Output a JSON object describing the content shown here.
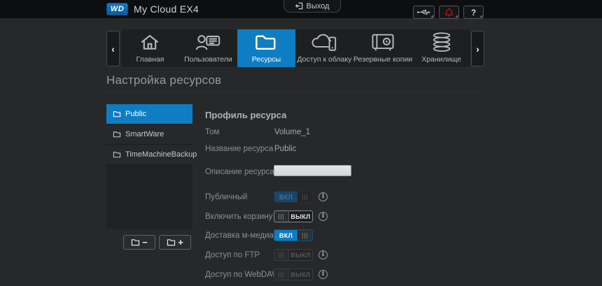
{
  "header": {
    "brand": {
      "logo": "WD",
      "title": "My Cloud EX4"
    },
    "logout_label": "Выход",
    "help_glyph": "?"
  },
  "nav": {
    "prev_glyph": "‹",
    "next_glyph": "›",
    "tabs": [
      {
        "label": "Главная",
        "icon": "home-icon",
        "active": false
      },
      {
        "label": "Пользователи",
        "icon": "users-icon",
        "active": false
      },
      {
        "label": "Ресурсы",
        "icon": "folder-icon",
        "active": true
      },
      {
        "label": "Доступ к облаку",
        "icon": "cloud-access-icon",
        "active": false
      },
      {
        "label": "Резервные копии",
        "icon": "backup-safe-icon",
        "active": false
      },
      {
        "label": "Хранилище",
        "icon": "storage-stack-icon",
        "active": false
      }
    ]
  },
  "page": {
    "title": "Настройка ресурсов"
  },
  "shares": {
    "items": [
      {
        "name": "Public",
        "selected": true
      },
      {
        "name": "SmartWare",
        "selected": false
      },
      {
        "name": "TimeMachineBackup",
        "selected": false
      }
    ],
    "remove_glyph": "−",
    "add_glyph": "+"
  },
  "profile": {
    "title": "Профиль ресурса",
    "volume_label": "Том",
    "volume_value": "Volume_1",
    "name_label": "Название ресурса",
    "name_value": "Public",
    "description_label": "Описание ресурса",
    "description_value": "",
    "info_glyph": "i",
    "toggles": [
      {
        "label": "Публичный",
        "state": "on",
        "text": "ВКЛ",
        "enabled": false,
        "info": true
      },
      {
        "label": "Включить корзину",
        "state": "off",
        "text": "ВЫКЛ",
        "enabled": true,
        "info": true
      },
      {
        "label": "Доставка м-медиа",
        "state": "on",
        "text": "ВКЛ",
        "enabled": true,
        "info": false
      },
      {
        "label": "Доступ по FTP",
        "state": "off",
        "text": "ВЫКЛ",
        "enabled": false,
        "info": true
      },
      {
        "label": "Доступ по WebDAV",
        "state": "off",
        "text": "ВЫКЛ",
        "enabled": false,
        "info": true
      }
    ]
  },
  "colors": {
    "accent": "#0e7dc2",
    "alert": "#d01818",
    "header_bg": "#0c0e10",
    "page_bg": "#26282a"
  }
}
